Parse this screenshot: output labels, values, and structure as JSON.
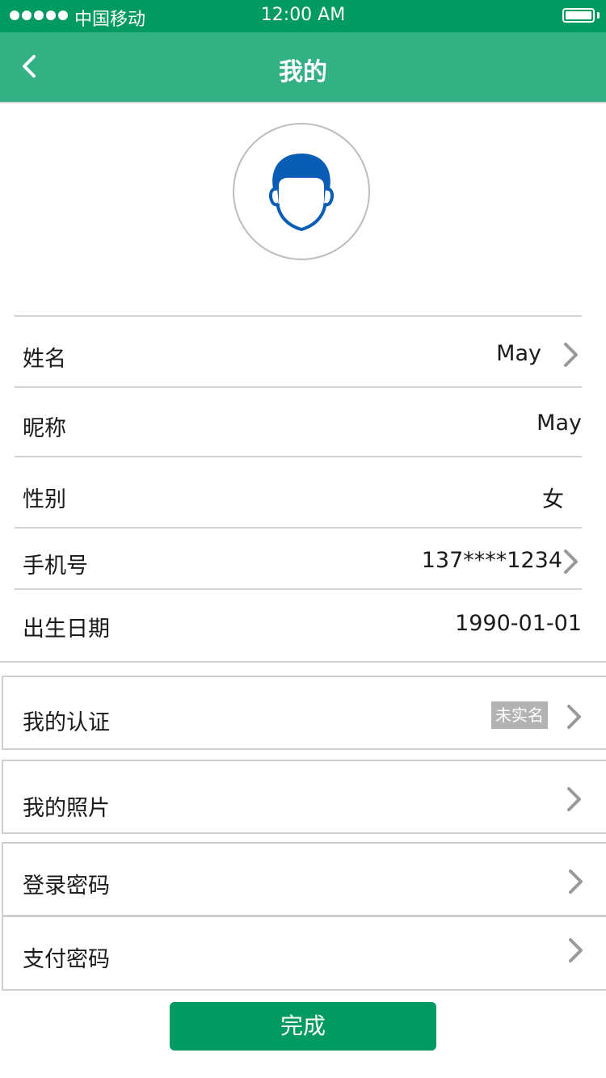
{
  "status_bar": {
    "carrier": "中国移动",
    "time": "12:00 AM",
    "signal_bars": 5
  },
  "nav": {
    "title": "我的",
    "back_icon": "chevron-left-icon"
  },
  "profile": {
    "avatar_icon": "person-head-icon",
    "rows": [
      {
        "label": "姓名",
        "value": "May",
        "has_arrow": true
      },
      {
        "label": "昵称",
        "value": "May",
        "has_arrow": false
      },
      {
        "label": "性别",
        "value": "女",
        "has_arrow": false
      },
      {
        "label": "手机号",
        "value": "137****1234",
        "has_arrow": true
      },
      {
        "label": "出生日期",
        "value": "1990-01-01",
        "has_arrow": false
      }
    ]
  },
  "menu": {
    "certification": {
      "label": "我的认证",
      "badge": "未实名"
    },
    "photos": {
      "label": "我的照片"
    },
    "login_password": {
      "label": "登录密码"
    },
    "pay_password": {
      "label": "支付密码"
    }
  },
  "actions": {
    "done_label": "完成"
  },
  "colors": {
    "status_bar": "#009a62",
    "nav_bar": "#33b084",
    "avatar_blue": "#0a5db5",
    "button": "#009a62",
    "badge": "#b3b3b3",
    "chevron": "#9a9a9a"
  }
}
